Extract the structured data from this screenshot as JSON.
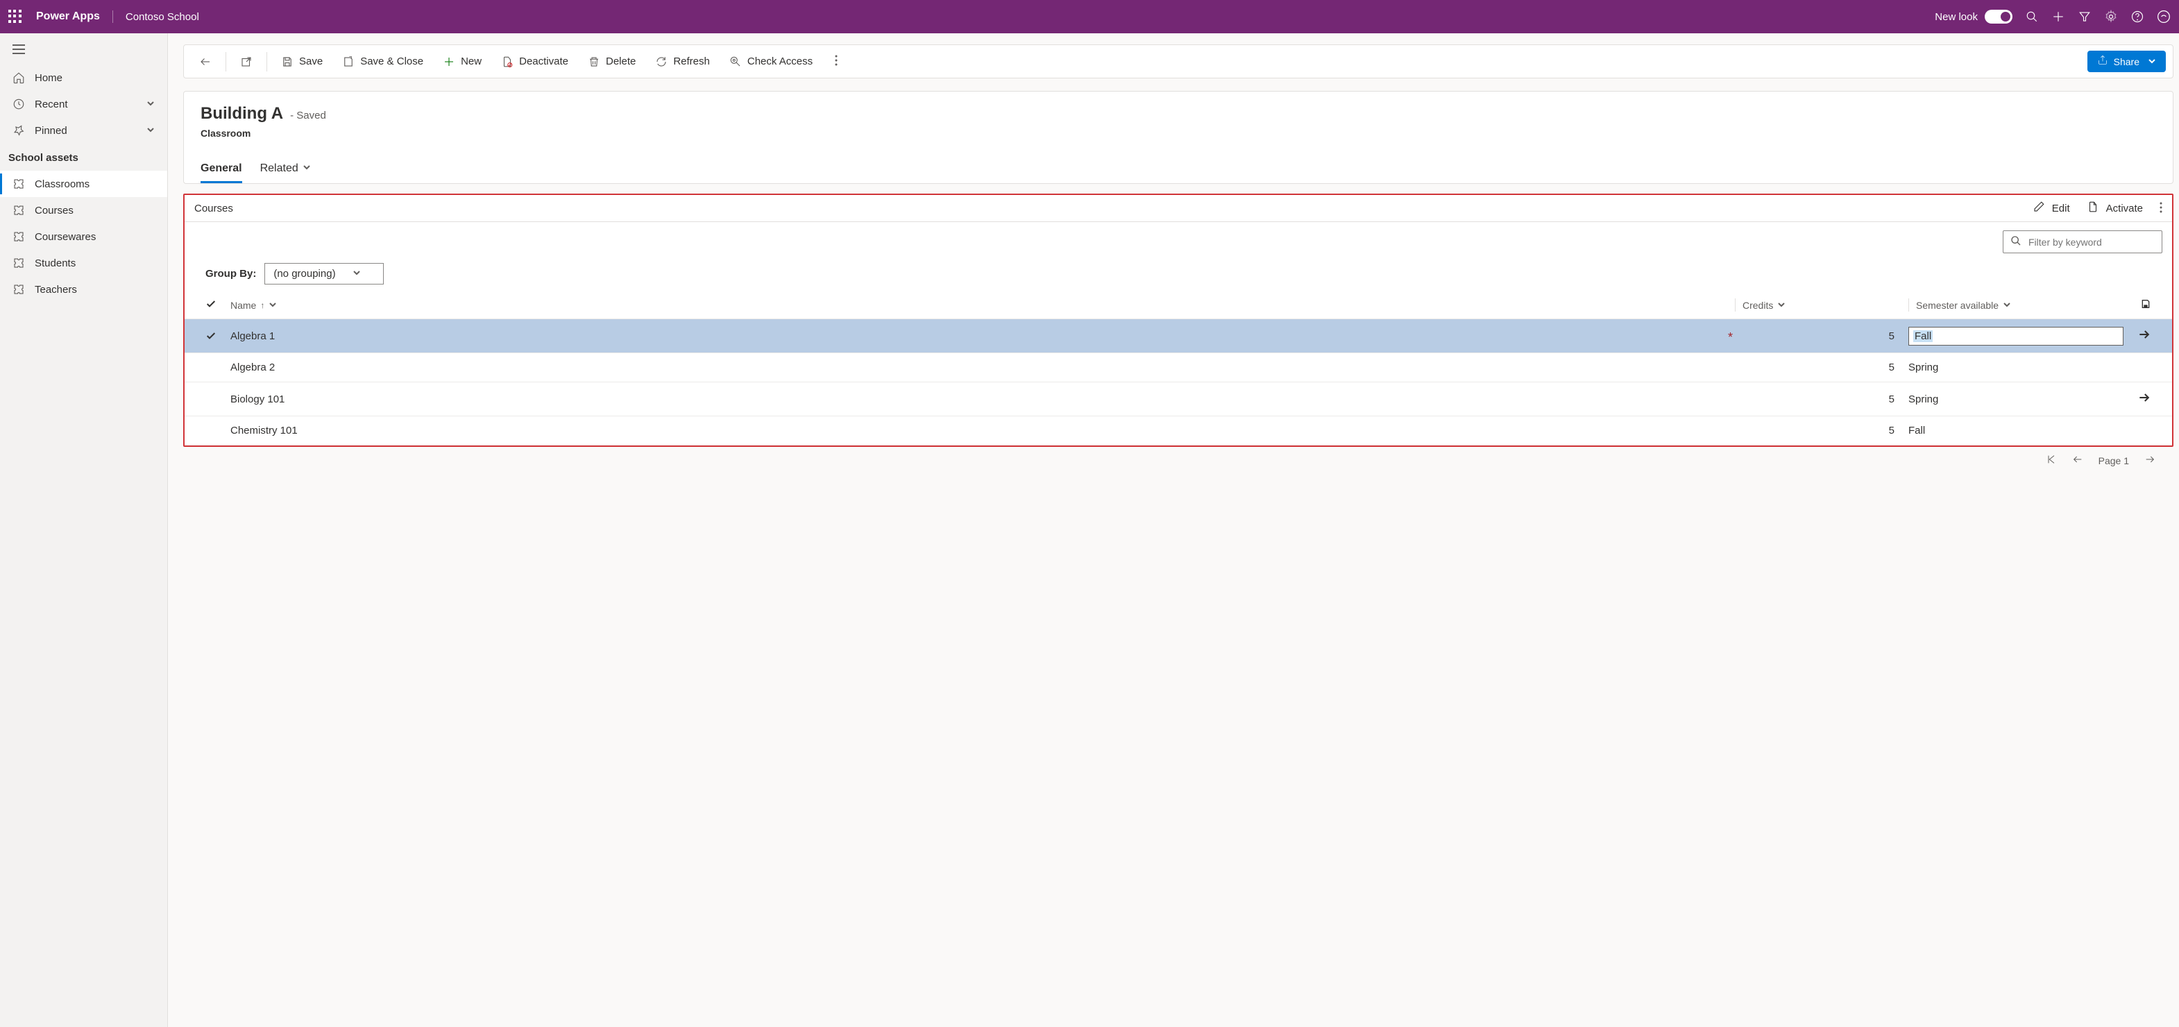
{
  "header": {
    "brand": "Power Apps",
    "app_name": "Contoso School",
    "new_look_label": "New look"
  },
  "sidebar": {
    "home": "Home",
    "recent": "Recent",
    "pinned": "Pinned",
    "group": "School assets",
    "items": [
      "Classrooms",
      "Courses",
      "Coursewares",
      "Students",
      "Teachers"
    ]
  },
  "commands": {
    "save": "Save",
    "save_close": "Save & Close",
    "new": "New",
    "deactivate": "Deactivate",
    "delete": "Delete",
    "refresh": "Refresh",
    "check_access": "Check Access",
    "share": "Share"
  },
  "record": {
    "title": "Building A",
    "status": "- Saved",
    "entity": "Classroom",
    "tabs": {
      "general": "General",
      "related": "Related"
    }
  },
  "subgrid": {
    "title": "Courses",
    "edit": "Edit",
    "activate": "Activate",
    "filter_placeholder": "Filter by keyword",
    "groupby_label": "Group By:",
    "groupby_value": "(no grouping)",
    "columns": {
      "name": "Name",
      "credits": "Credits",
      "semester": "Semester available"
    },
    "rows": [
      {
        "name": "Algebra 1",
        "credits": "5",
        "semester": "Fall",
        "selected": true,
        "editing": true,
        "arrow": true,
        "required_credits": true
      },
      {
        "name": "Algebra 2",
        "credits": "5",
        "semester": "Spring",
        "selected": false,
        "editing": false,
        "arrow": false
      },
      {
        "name": "Biology 101",
        "credits": "5",
        "semester": "Spring",
        "selected": false,
        "editing": false,
        "arrow": true
      },
      {
        "name": "Chemistry 101",
        "credits": "5",
        "semester": "Fall",
        "selected": false,
        "editing": false,
        "arrow": false
      }
    ]
  },
  "pager": {
    "page": "Page 1"
  }
}
